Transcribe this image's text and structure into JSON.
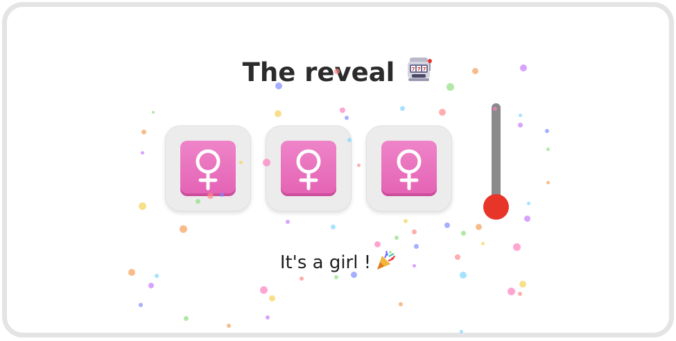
{
  "title": "The reveal",
  "title_icon": "slot-machine-icon",
  "reels": [
    {
      "symbol": "female-sign-icon"
    },
    {
      "symbol": "female-sign-icon"
    },
    {
      "symbol": "female-sign-icon"
    }
  ],
  "lever": {
    "knob_color": "#e8352a",
    "bar_color": "#8a8a8a"
  },
  "result": {
    "text": "It's a girl !",
    "icon": "party-popper-icon"
  },
  "colors": {
    "tile_pink": "#e462b4",
    "slot_bg": "#ececec",
    "frame_border": "#e4e4e4",
    "confetti": [
      "#ff8a8a",
      "#7f8cff",
      "#8de07f",
      "#f5a05a",
      "#c77bff",
      "#7fd6ff",
      "#ff7fbf",
      "#f5d35a"
    ]
  }
}
